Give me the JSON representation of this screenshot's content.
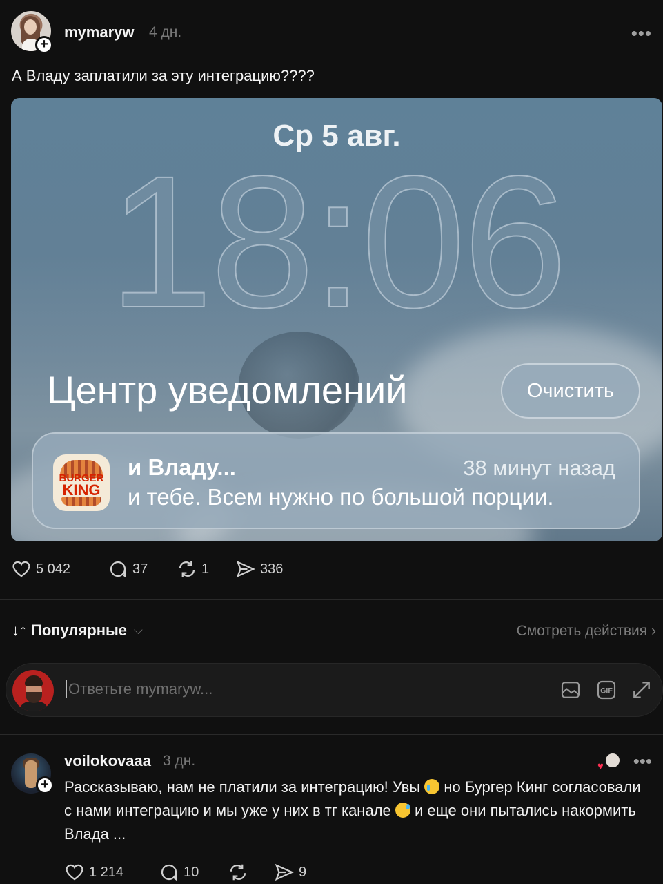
{
  "post": {
    "username": "mymaryw",
    "time": "4 дн.",
    "more": "•••",
    "plus": "+",
    "text": "А Владу заплатили за эту интеграцию????",
    "media": {
      "date": "Ср 5 авг.",
      "clock": "18:06",
      "nc_title": "Центр уведомлений",
      "clear_label": "Очистить",
      "notification": {
        "logo_text_1": "BURGER",
        "logo_text_2": "KING",
        "title": "и Владу...",
        "time": "38 минут назад",
        "body": "и тебе. Всем нужно по большой порции."
      }
    },
    "stats": {
      "likes": "5 042",
      "comments": "37",
      "reposts": "1",
      "shares": "336"
    }
  },
  "sort": {
    "icon": "↓↑",
    "label": "Популярные",
    "chevron": "⌵",
    "activity_label": "Смотреть действия ›"
  },
  "reply": {
    "placeholder": "Ответьте mymaryw..."
  },
  "comment": {
    "username": "voilokovaaa",
    "time": "3 дн.",
    "more": "•••",
    "plus": "+",
    "heart": "♥",
    "text_1": "Рассказываю, нам не платили за интеграцию! Увы ",
    "text_2": " но Бургер Кинг согласовали с нами интеграцию и мы уже у них в тг канале ",
    "text_3": " и еще они пытались накормить Влада ...",
    "stats": {
      "likes": "1 214",
      "comments": "10",
      "reposts": "",
      "shares": "9"
    }
  },
  "icons": {
    "heart": "heart-icon",
    "comment": "comment-icon",
    "repost": "repost-icon",
    "share": "share-icon",
    "image": "image-icon",
    "gif": "gif-icon",
    "expand": "expand-icon"
  }
}
